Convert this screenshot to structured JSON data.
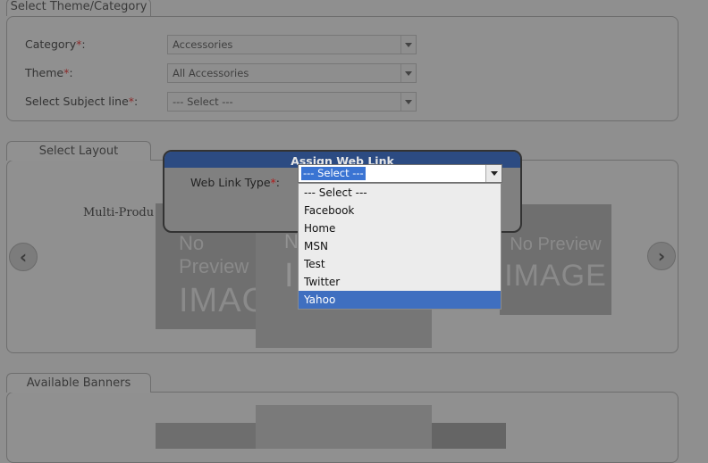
{
  "theme_section": {
    "legend": "Select Theme/Category",
    "fields": [
      {
        "label": "Category",
        "required": "*",
        "suffix": ":",
        "value": "Accessories"
      },
      {
        "label": "Theme",
        "required": "*",
        "suffix": ":",
        "value": "All Accessories"
      },
      {
        "label": "Select Subject line",
        "required": "*",
        "suffix": ":",
        "value": "--- Select ---"
      }
    ]
  },
  "layout_section": {
    "legend": "Select Layout",
    "layout_name": "Multi-Produ",
    "previews": [
      {
        "line1": "No Preview",
        "line2": "IMAG"
      },
      {
        "line1": "N",
        "line2": "I"
      },
      {
        "line1": "No Preview",
        "line2": "IMAGE"
      }
    ],
    "prev_icon": "chevron-left-icon",
    "next_icon": "chevron-right-icon"
  },
  "banners_section": {
    "legend": "Available Banners"
  },
  "dialog": {
    "title": "Assign Web Link",
    "field_label": "Web Link Type",
    "required": "*",
    "suffix": ":",
    "selected_value": "--- Select ---",
    "options": [
      "--- Select ---",
      "Facebook",
      "Home",
      "MSN",
      "Test",
      "Twitter",
      "Yahoo"
    ],
    "highlighted_option": "Yahoo"
  },
  "colors": {
    "dialog_title_bg": "#2c4b82",
    "highlight": "#3f6fc0",
    "required": "#8b2b2b"
  }
}
